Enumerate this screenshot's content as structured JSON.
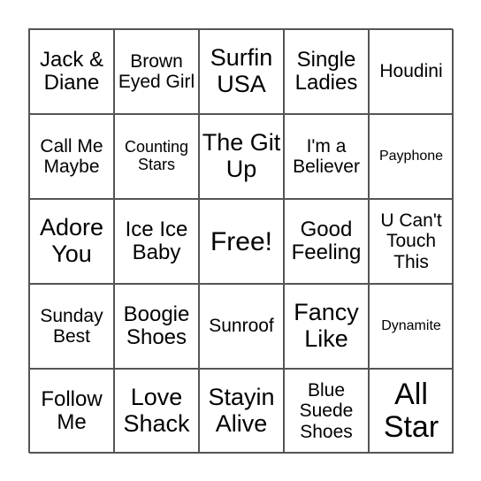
{
  "board": {
    "cells": [
      {
        "text": "Jack & Diane",
        "size": "s4"
      },
      {
        "text": "Brown Eyed Girl",
        "size": "s1"
      },
      {
        "text": "Surfin USA",
        "size": "s2"
      },
      {
        "text": "Single Ladies",
        "size": "s4"
      },
      {
        "text": "Houdini",
        "size": "s1"
      },
      {
        "text": "Call Me Maybe",
        "size": "s1"
      },
      {
        "text": "Counting Stars",
        "size": "s3"
      },
      {
        "text": "The Git Up",
        "size": "s2"
      },
      {
        "text": "I'm a Believer",
        "size": "s1"
      },
      {
        "text": "Payphone",
        "size": "s5"
      },
      {
        "text": "Adore You",
        "size": "s2"
      },
      {
        "text": "Ice Ice Baby",
        "size": "s4"
      },
      {
        "text": "Free!",
        "size": "s7"
      },
      {
        "text": "Good Feeling",
        "size": "s4"
      },
      {
        "text": "U Can't Touch This",
        "size": "s1"
      },
      {
        "text": "Sunday Best",
        "size": "s1"
      },
      {
        "text": "Boogie Shoes",
        "size": "s4"
      },
      {
        "text": "Sunroof",
        "size": "s1"
      },
      {
        "text": "Fancy Like",
        "size": "s2"
      },
      {
        "text": "Dynamite",
        "size": "s5"
      },
      {
        "text": "Follow Me",
        "size": "s4"
      },
      {
        "text": "Love Shack",
        "size": "s2"
      },
      {
        "text": "Stayin Alive",
        "size": "s2"
      },
      {
        "text": "Blue Suede Shoes",
        "size": "s1"
      },
      {
        "text": "All Star",
        "size": "s6"
      }
    ]
  }
}
